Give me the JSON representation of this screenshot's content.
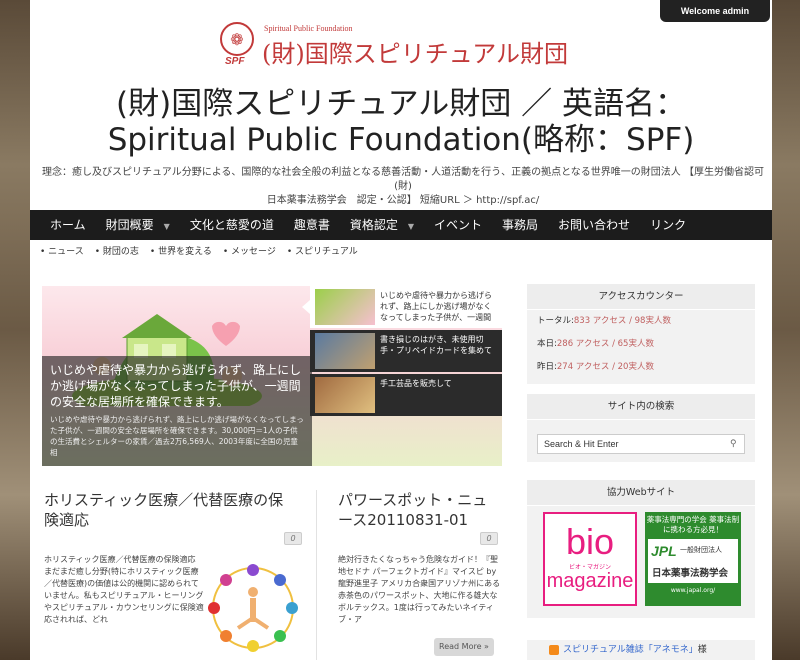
{
  "admin": {
    "welcome": "Welcome admin"
  },
  "logo": {
    "en_text": "Spiritual Public Foundation",
    "jp_text": "(財)国際スピリチュアル財団",
    "mark": "SPF"
  },
  "site_title": {
    "line1": "(財)国際スピリチュアル財団 ／ 英語名：",
    "line2": "Spiritual Public Foundation(略称：SPF)"
  },
  "tagline": {
    "line1": "理念：癒し及びスピリチュアル分野による、国際的な社会全般の利益となる慈善活動・人道活動を行う、正義の拠点となる世界唯一の財団法人 【厚生労働省認可(財)",
    "line2": "日本薬事法務学会　認定・公認】 短縮URL ＞ http://spf.ac/"
  },
  "nav": {
    "items": [
      {
        "label": "ホーム",
        "dropdown": false
      },
      {
        "label": "財団概要",
        "dropdown": true
      },
      {
        "label": "文化と慈愛の道",
        "dropdown": false
      },
      {
        "label": "趣意書",
        "dropdown": false
      },
      {
        "label": "資格認定",
        "dropdown": true
      },
      {
        "label": "イベント",
        "dropdown": false
      },
      {
        "label": "事務局",
        "dropdown": false
      },
      {
        "label": "お問い合わせ",
        "dropdown": false
      },
      {
        "label": "リンク",
        "dropdown": false
      }
    ],
    "caret": "▼"
  },
  "subnav": [
    "ニュース",
    "財団の志",
    "世界を変える",
    "メッセージ",
    "スピリチュアル"
  ],
  "slider": {
    "caption_big": "いじめや虐待や暴力から逃げられず、路上にしか逃げ場がなくなってしまった子供が、一週間の安全な居場所を確保できます。",
    "caption_small": "いじめや虐待や暴力から逃げられず、路上にしか逃げ場がなくなってしまった子供が、一週間の安全な居場所を確保できます。30,000円＝1人の子供の生活費とシェルターの家賃／過去2万6,569人、2003年度に全国の児童相",
    "thumbs": [
      {
        "text": "いじめや虐待や暴力から逃げられず、路上にしか逃げ場がなくなってしまった子供が、一週間の安全な居場所を確保",
        "active": true
      },
      {
        "text": "書き損じのはがき、未使用切手・プリペイドカードを集めて",
        "active": false
      },
      {
        "text": "手工芸品を販売して",
        "active": false
      }
    ]
  },
  "posts": [
    {
      "title": "ホリスティック医療／代替医療の保険適応",
      "comments": "0",
      "body": "ホリスティック医療／代替医療の保険適応 まだまだ癒し分野(特にホリスティック医療／代替医療)の価値は公的機関に認められていません。私もスピリチュアル・ヒーリングやスピリチュアル・カウンセリングに保険適応されれば、どれ"
    },
    {
      "title": "パワースポット・ニュース20110831-01",
      "comments": "0",
      "body": "絶対行きたくなっちゃう危険なガイド！『聖地セドナ パーフェクトガイド』マイスピ by 龍野進里子 アメリカ合衆国アリゾナ州にある赤茶色のパワースポット、大地に作る雄大なボルテックス。1度は行ってみたいネイティブ・ア",
      "read_more": "Read More »"
    }
  ],
  "sidebar": {
    "counter": {
      "title": "アクセスカウンター",
      "rows": [
        {
          "label": "トータル:",
          "value": "833 アクセス / 98実人数"
        },
        {
          "label": "本日:",
          "value": "286 アクセス / 65実人数"
        },
        {
          "label": "昨日:",
          "value": "274 アクセス / 20実人数"
        }
      ]
    },
    "search": {
      "title": "サイト内の検索",
      "placeholder": "Search & Hit Enter"
    },
    "partners": {
      "title": "協力Webサイト",
      "bio": {
        "main": "bio",
        "sub": "ビオ・マガジン",
        "mag": "magazine"
      },
      "jpl": {
        "top": "薬事法専門の学会 薬事法制に携わる方必見！",
        "logo": "JPL",
        "org1": "一般財団法人",
        "org2": "日本薬事法務学会",
        "url": "www.japal.org/"
      }
    },
    "rss": {
      "name": "スピリチュアル雑誌「アネモネ」",
      "suffix": "様"
    }
  },
  "colors": {
    "accent": "#c23a3a",
    "nav_bg": "#1c1c1c",
    "counter_num": "#c06060",
    "bio_pink": "#e81e80",
    "jpl_green": "#2e8b2e"
  }
}
